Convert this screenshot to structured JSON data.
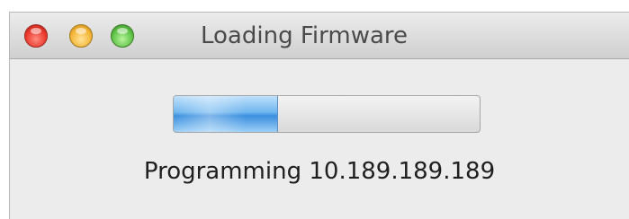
{
  "window": {
    "title": "Loading Firmware",
    "controls": {
      "close_icon": "close-icon",
      "minimize_icon": "minimize-icon",
      "zoom_icon": "zoom-icon"
    }
  },
  "progress": {
    "fraction": 0.34,
    "accent_color": "#4a9be6"
  },
  "status": {
    "text": "Programming 10.189.189.189"
  }
}
